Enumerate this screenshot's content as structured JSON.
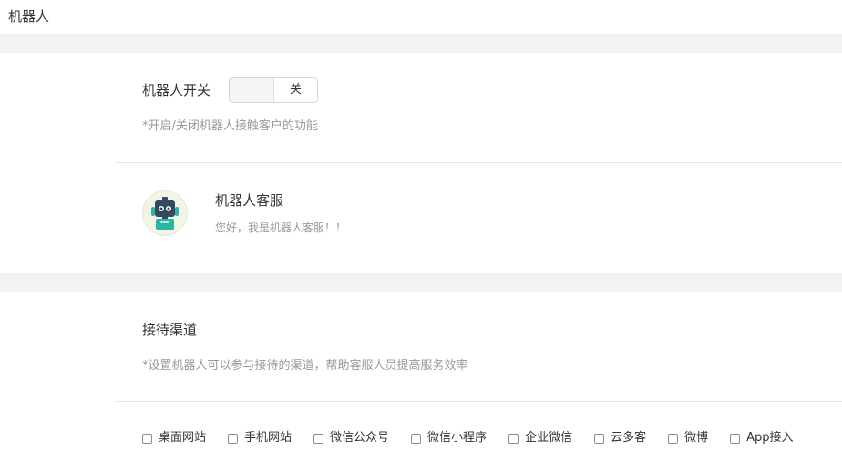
{
  "header": {
    "title": "机器人"
  },
  "robot_switch": {
    "label": "机器人开关",
    "state_label": "关",
    "description": "*开启/关闭机器人接触客户的功能"
  },
  "robot_profile": {
    "avatar_icon": "robot-icon",
    "name": "机器人客服",
    "greeting": "您好，我是机器人客服！！"
  },
  "channels_section": {
    "title": "接待渠道",
    "description": "*设置机器人可以参与接待的渠道，帮助客服人员提高服务效率",
    "options": [
      {
        "label": "桌面网站",
        "checked": false
      },
      {
        "label": "手机网站",
        "checked": false
      },
      {
        "label": "微信公众号",
        "checked": false
      },
      {
        "label": "微信小程序",
        "checked": false
      },
      {
        "label": "企业微信",
        "checked": false
      },
      {
        "label": "云多客",
        "checked": false
      },
      {
        "label": "微博",
        "checked": false
      },
      {
        "label": "App接入",
        "checked": false
      }
    ]
  },
  "colors": {
    "band": "#f1f2f4",
    "divider": "#e5e5e5",
    "muted_text": "#999999",
    "robot_teal": "#2bb3a3",
    "robot_dark": "#34495e"
  }
}
